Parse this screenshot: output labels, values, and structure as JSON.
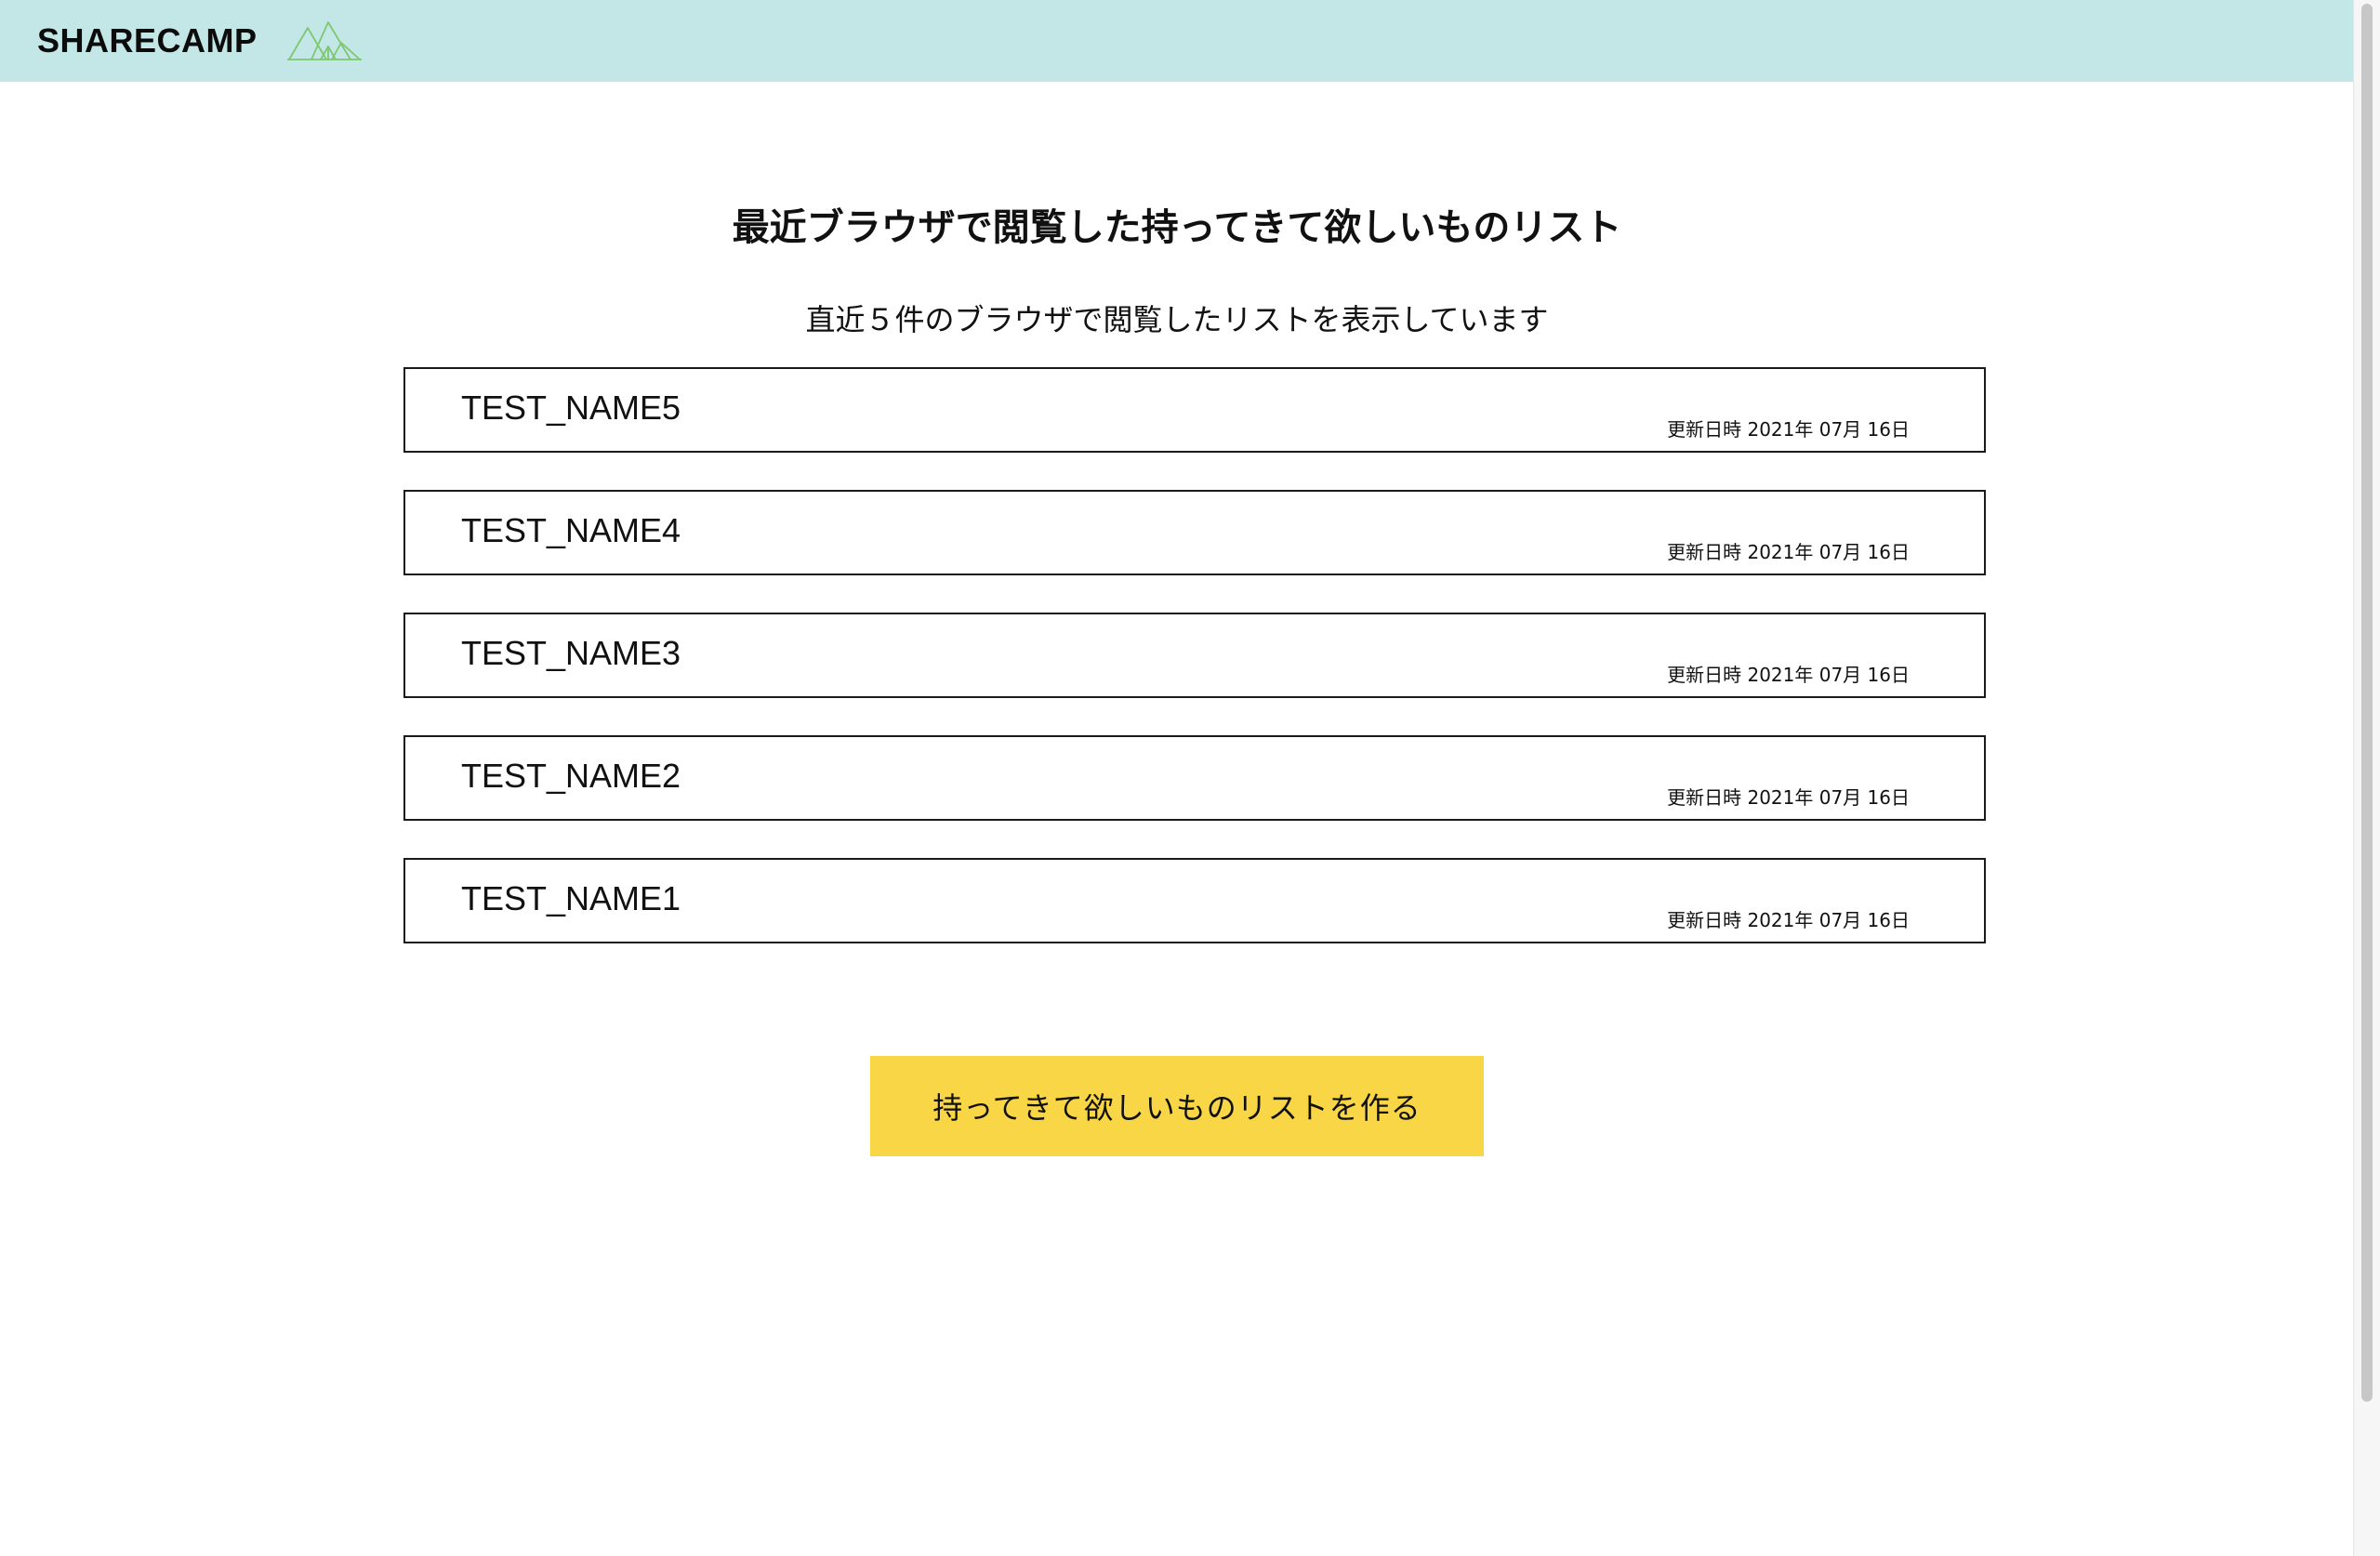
{
  "header": {
    "brand": "SHARECAMP",
    "logo_icon": "mountain-tent-icon",
    "background": "#c3e7e6"
  },
  "main": {
    "title": "最近ブラウザで閲覧した持ってきて欲しいものリスト",
    "subtitle": "直近５件のブラウザで閲覧したリストを表示しています"
  },
  "lists": [
    {
      "name": "TEST_NAME5",
      "updated": "更新日時 2021年 07月 16日"
    },
    {
      "name": "TEST_NAME4",
      "updated": "更新日時 2021年 07月 16日"
    },
    {
      "name": "TEST_NAME3",
      "updated": "更新日時 2021年 07月 16日"
    },
    {
      "name": "TEST_NAME2",
      "updated": "更新日時 2021年 07月 16日"
    },
    {
      "name": "TEST_NAME1",
      "updated": "更新日時 2021年 07月 16日"
    }
  ],
  "create_button": {
    "label": "持ってきて欲しいものリストを作る",
    "color": "#f9d645"
  }
}
